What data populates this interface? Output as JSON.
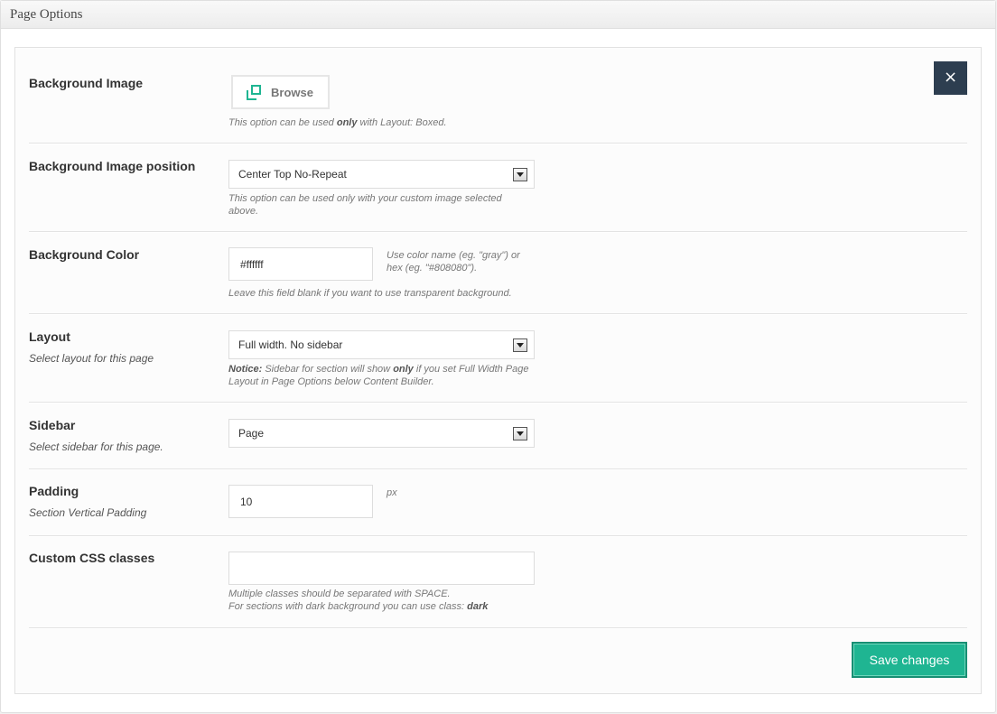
{
  "box": {
    "title": "Page Options"
  },
  "close_icon": "×",
  "background_image": {
    "label": "Background Image",
    "browse_label": "Browse",
    "desc_before": "This option can be used ",
    "desc_bold": "only",
    "desc_after": " with Layout: Boxed."
  },
  "background_position": {
    "label": "Background Image position",
    "value": "Center Top No-Repeat",
    "desc_line1": "This option can be used only with your custom image selected",
    "desc_line2": "above."
  },
  "background_color": {
    "label": "Background Color",
    "value": "#ffffff",
    "hint_line1": "Use color name (eg. \"gray\") or",
    "hint_line2": "hex (eg. \"#808080\").",
    "desc": "Leave this field blank if you want to use transparent background."
  },
  "layout": {
    "label": "Layout",
    "sublabel": "Select layout for this page",
    "value": "Full width. No sidebar",
    "notice_bold": "Notice:",
    "notice_mid": " Sidebar for section will show ",
    "notice_only": "only",
    "notice_after": " if you set Full Width Page",
    "notice_line2": "Layout in Page Options below Content Builder."
  },
  "sidebar": {
    "label": "Sidebar",
    "sublabel": "Select sidebar for this page.",
    "value": "Page"
  },
  "padding": {
    "label": "Padding",
    "sublabel": "Section Vertical Padding",
    "value": "10",
    "unit": "px"
  },
  "custom_css": {
    "label": "Custom CSS classes",
    "value": "",
    "desc_line1": "Multiple classes should be separated with SPACE.",
    "desc_line2_before": "For sections with dark background you can use class: ",
    "desc_line2_bold": "dark"
  },
  "save_label": "Save changes",
  "colors": {
    "accent": "#1fb592",
    "close_bg": "#2d3e50"
  }
}
